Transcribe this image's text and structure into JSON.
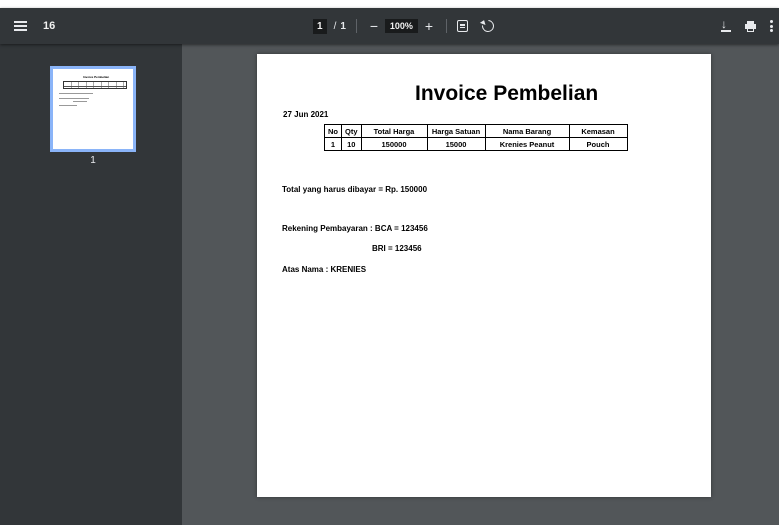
{
  "toolbar": {
    "doc_title": "16",
    "current_page": "1",
    "page_separator": "/",
    "total_pages": "1",
    "zoom_out": "−",
    "zoom_level": "100%",
    "zoom_in": "+",
    "icons": [
      "menu-icon",
      "fit-page-icon",
      "rotate-icon",
      "download-icon",
      "print-icon",
      "more-options-icon"
    ]
  },
  "sidebar": {
    "thumbnail_page_number": "1",
    "thumbnail_title": "Invoice Pembelian"
  },
  "invoice": {
    "title": "Invoice Pembelian",
    "date": "27 Jun 2021",
    "table": {
      "headers": [
        "No",
        "Qty",
        "Total Harga",
        "Harga Satuan",
        "Nama Barang",
        "Kemasan"
      ],
      "rows": [
        [
          "1",
          "10",
          "150000",
          "15000",
          "Krenies Peanut",
          "Pouch"
        ]
      ]
    },
    "total_line": "Total yang harus dibayar = Rp. 150000",
    "bank_line_1": "Rekening Pembayaran : BCA = 123456",
    "bank_line_2": "BRI = 123456",
    "account_name": "Atas Nama : KRENIES"
  },
  "colors": {
    "toolbar_bg": "#323639",
    "sidebar_bg": "#323639",
    "viewer_bg": "#525659",
    "thumbnail_highlight": "#8ab4f8"
  }
}
